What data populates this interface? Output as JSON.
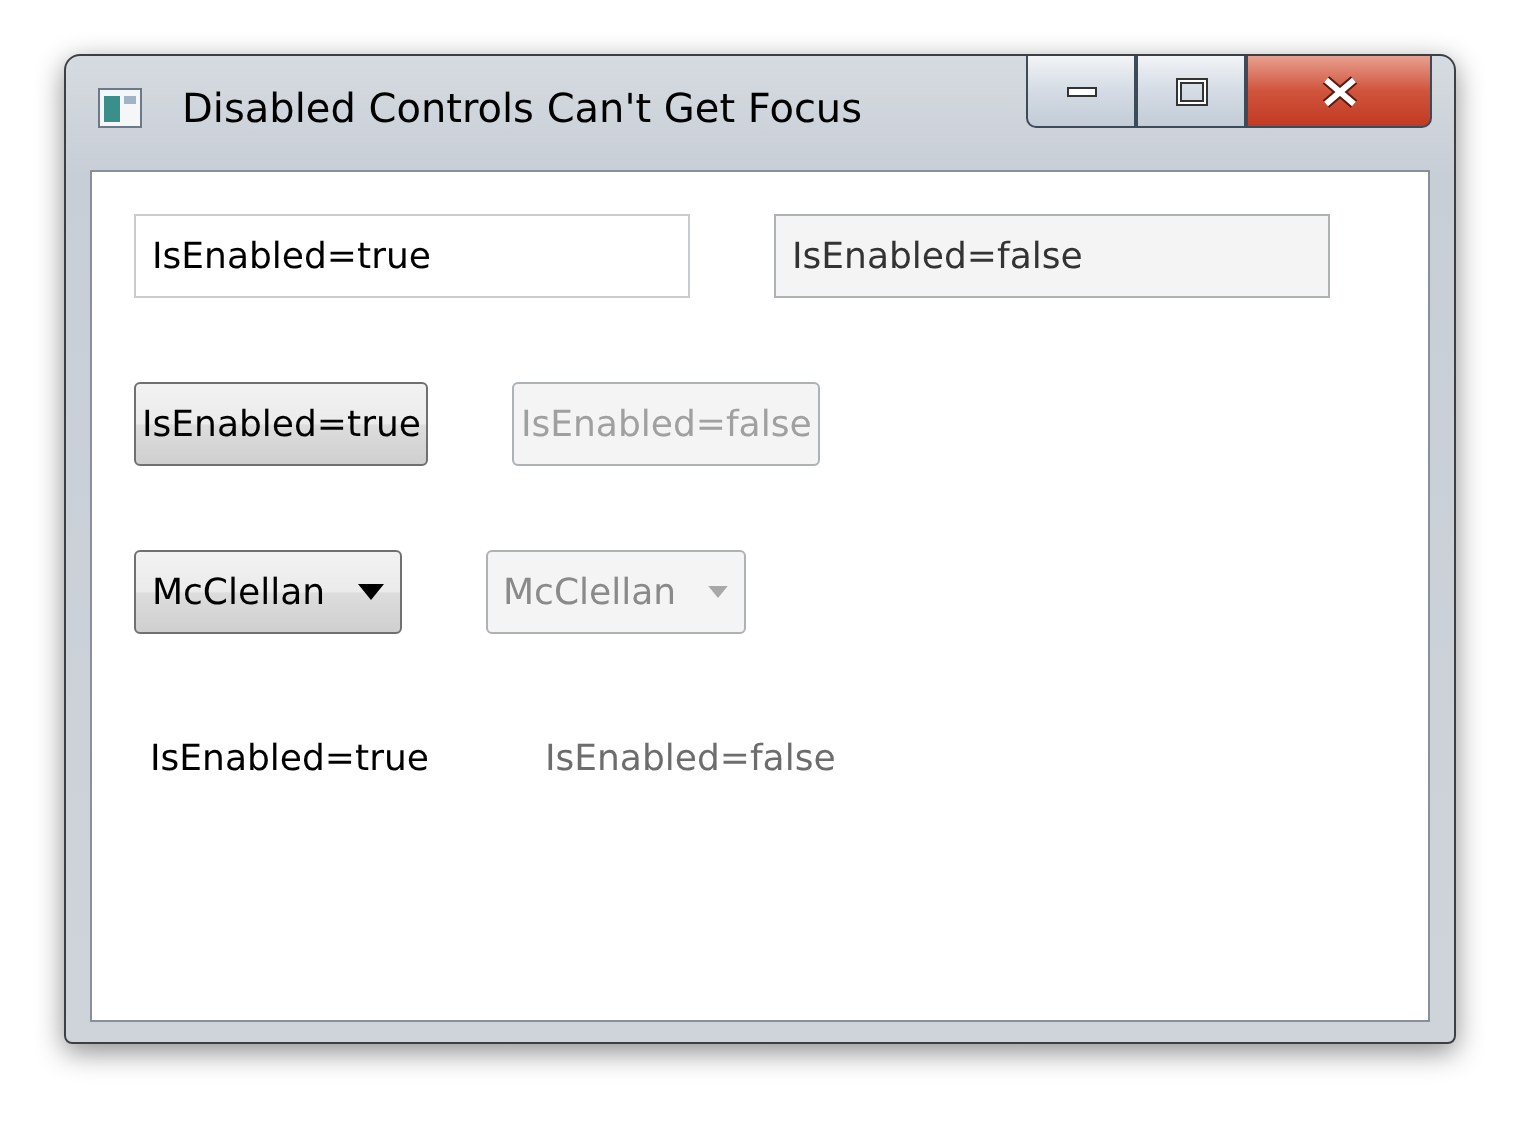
{
  "window": {
    "title": "Disabled Controls Can't Get Focus"
  },
  "rows": [
    {
      "kind": "textbox",
      "items": [
        {
          "text": "IsEnabled=true",
          "disabled": false
        },
        {
          "text": "IsEnabled=false",
          "disabled": true
        }
      ]
    },
    {
      "kind": "button",
      "items": [
        {
          "text": "IsEnabled=true",
          "disabled": false
        },
        {
          "text": "IsEnabled=false",
          "disabled": true
        }
      ]
    },
    {
      "kind": "combobox",
      "items": [
        {
          "text": "McClellan",
          "disabled": false
        },
        {
          "text": "McClellan",
          "disabled": true
        }
      ]
    },
    {
      "kind": "label",
      "items": [
        {
          "text": "IsEnabled=true",
          "disabled": false
        },
        {
          "text": "IsEnabled=false",
          "disabled": true
        }
      ]
    }
  ]
}
